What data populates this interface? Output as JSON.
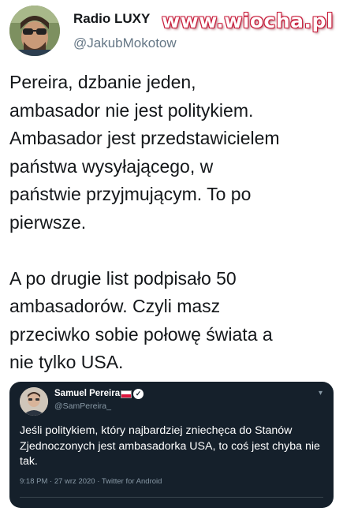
{
  "author": {
    "name": "Radio LUXY",
    "handle": "@JakubMokotow"
  },
  "watermark": "www.wiocha.pl",
  "tweet": {
    "text": "Pereira, dzbanie jeden,\nambasador nie jest politykiem.\nAmbasador jest przedstawicielem\npaństwa wysyłającego, w\npaństwie przyjmującym. To po\npierwsze.\n\nA po drugie list podpisało 50\nambasadorów. Czyli masz\nprzeciwko sobie połowę świata a\nnie tylko USA."
  },
  "quoted_tweet": {
    "author_name": "Samuel Pereira",
    "handle": "@SamPereira_",
    "flag_icon": "poland-flag-icon",
    "verified_icon": "verified-badge-icon",
    "text": "Jeśli politykiem, który najbardziej zniechęca do Stanów Zjednoczonych jest ambasadorka USA, to coś jest chyba nie tak.",
    "timestamp": "9:18 PM · 27 wrz 2020 · Twitter for Android",
    "colors": {
      "background": "#15202b",
      "text": "#ffffff",
      "muted": "#8899a6"
    }
  }
}
